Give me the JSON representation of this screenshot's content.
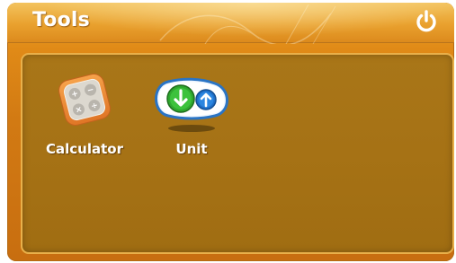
{
  "window": {
    "title": "Tools"
  },
  "header": {
    "power_icon": "power-icon"
  },
  "tools": [
    {
      "label": "Calculator",
      "icon": "calculator-icon"
    },
    {
      "label": "Unit",
      "icon": "unit-converter-icon"
    }
  ],
  "colors": {
    "frame": "#e08a17",
    "title_bar": "#e9a12e",
    "panel": "#a67215",
    "panel_border": "#e9b04a",
    "text": "#ffffff",
    "unit_green": "#2fae2f",
    "unit_blue": "#1f6fc8"
  }
}
